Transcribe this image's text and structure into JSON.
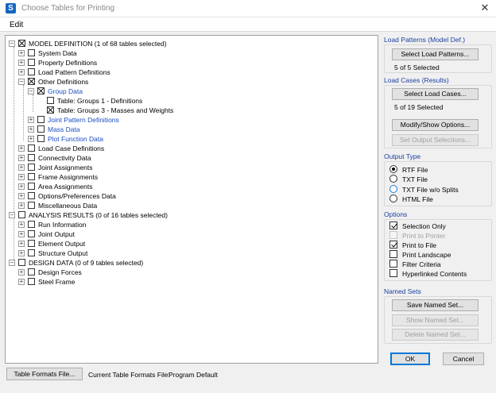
{
  "window": {
    "title": "Choose Tables for Printing",
    "app_icon_letter": "S",
    "close_glyph": "✕"
  },
  "menu": {
    "edit": "Edit"
  },
  "tree": {
    "expand_glyph": "+",
    "collapse_glyph": "−",
    "model_definition": "MODEL DEFINITION  (1 of 68 tables selected)",
    "system_data": "System Data",
    "property_definitions": "Property Definitions",
    "load_pattern_definitions": "Load Pattern Definitions",
    "other_definitions": "Other Definitions",
    "group_data": "Group Data",
    "table_groups1": "Table:  Groups 1 - Definitions",
    "table_groups3": "Table:  Groups 3 - Masses and Weights",
    "joint_pattern_definitions": "Joint Pattern Definitions",
    "mass_data": "Mass Data",
    "plot_function_data": "Plot Function Data",
    "load_case_definitions": "Load Case Definitions",
    "connectivity_data": "Connectivity Data",
    "joint_assignments": "Joint Assignments",
    "frame_assignments": "Frame Assignments",
    "area_assignments": "Area Assignments",
    "options_preferences_data": "Options/Preferences Data",
    "miscellaneous_data": "Miscellaneous Data",
    "analysis_results": "ANALYSIS RESULTS  (0 of 16 tables selected)",
    "run_information": "Run Information",
    "joint_output": "Joint Output",
    "element_output": "Element Output",
    "structure_output": "Structure Output",
    "design_data": "DESIGN DATA  (0 of 9 tables selected)",
    "design_forces": "Design Forces",
    "steel_frame": "Steel Frame"
  },
  "load_patterns": {
    "label": "Load Patterns (Model Def.)",
    "select_button": "Select Load Patterns...",
    "status": "5 of 5 Selected"
  },
  "load_cases": {
    "label": "Load Cases (Results)",
    "select_button": "Select Load Cases...",
    "status": "5 of 19 Selected",
    "modify_button": "Modify/Show Options...",
    "set_output_button": "Set Output Selections..."
  },
  "output_type": {
    "label": "Output Type",
    "rtf": "RTF File",
    "txt": "TXT File",
    "txt_splits": "TXT File w/o Splits",
    "html": "HTML File"
  },
  "options": {
    "label": "Options",
    "selection_only": "Selection Only",
    "print_to_printer": "Print to Printer",
    "print_to_file": "Print to File",
    "print_landscape": "Print Landscape",
    "filter_criteria": "Filter Criteria",
    "hyperlinked_contents": "Hyperlinked Contents"
  },
  "named_sets": {
    "label": "Named Sets",
    "save_button": "Save Named Set...",
    "show_button": "Show Named Set...",
    "delete_button": "Delete Named Set..."
  },
  "footer": {
    "ok": "OK",
    "cancel": "Cancel",
    "table_formats_button": "Table Formats File...",
    "current_formats_label": "Current Table Formats File:",
    "current_formats_value": "Program Default"
  }
}
